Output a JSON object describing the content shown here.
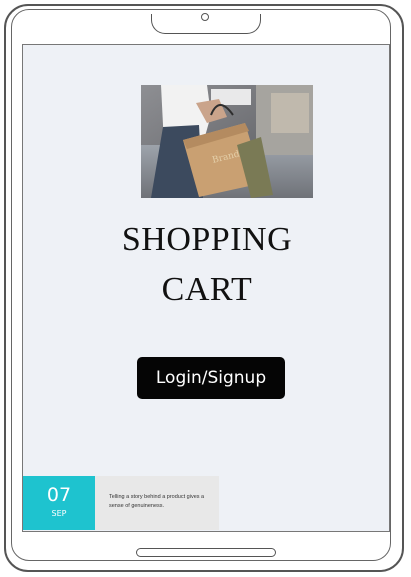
{
  "hero": {
    "image": "shopping-bag-photo"
  },
  "title": {
    "line1": "SHOPPING",
    "line2": "CART"
  },
  "actions": {
    "login_label": "Login/Signup"
  },
  "date_card": {
    "day": "07",
    "month": "SEP",
    "text": "Telling a story behind a product gives a sense of genuineness."
  },
  "colors": {
    "screen_bg": "#eef1f6",
    "button_bg": "#050505",
    "date_badge": "#1ec3cf"
  }
}
